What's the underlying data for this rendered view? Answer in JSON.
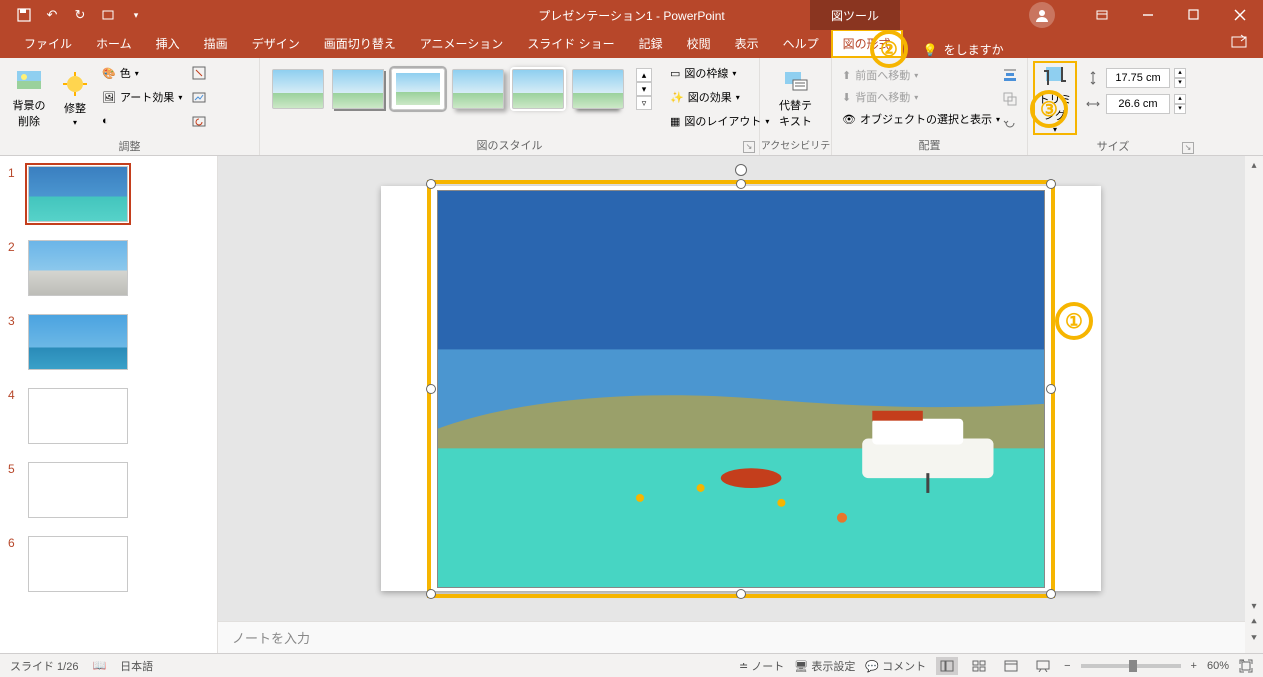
{
  "titlebar": {
    "title": "プレゼンテーション1 - PowerPoint",
    "tool_context": "図ツール"
  },
  "qat": {
    "save": "💾",
    "undo": "↶",
    "redo": "↻",
    "start": "▢"
  },
  "tabs": {
    "file": "ファイル",
    "home": "ホーム",
    "insert": "挿入",
    "draw": "描画",
    "design": "デザイン",
    "transitions": "画面切り替え",
    "animations": "アニメーション",
    "slideshow": "スライド ショー",
    "record": "記録",
    "review": "校閲",
    "view": "表示",
    "help": "ヘルプ",
    "picture_format": "図の形式",
    "tell_me": "をしますか"
  },
  "ribbon": {
    "remove_bg": "背景の\n削除",
    "corrections": "修整",
    "color": "色",
    "artistic": "アート効果",
    "group_adjust": "調整",
    "group_styles": "図のスタイル",
    "border": "図の枠線",
    "effects": "図の効果",
    "layout": "図のレイアウト",
    "alt_text": "代替テ\nキスト",
    "group_access": "アクセシビリティ",
    "bring_forward": "前面へ移動",
    "send_backward": "背面へ移動",
    "selection_pane": "オブジェクトの選択と表示",
    "group_arrange": "配置",
    "crop": "トリミング",
    "height": "17.75 cm",
    "width": "26.6 cm",
    "group_size": "サイズ"
  },
  "thumbs": {
    "n1": "1",
    "n2": "2",
    "n3": "3",
    "n4": "4",
    "n5": "5",
    "n6": "6"
  },
  "notes_placeholder": "ノートを入力",
  "status": {
    "slide": "スライド 1/26",
    "lang": "日本語",
    "notes_btn": "ノート",
    "display_settings": "表示設定",
    "comments": "コメント",
    "zoom": "60%"
  },
  "callouts": {
    "c1": "①",
    "c2": "②",
    "c3": "③"
  }
}
